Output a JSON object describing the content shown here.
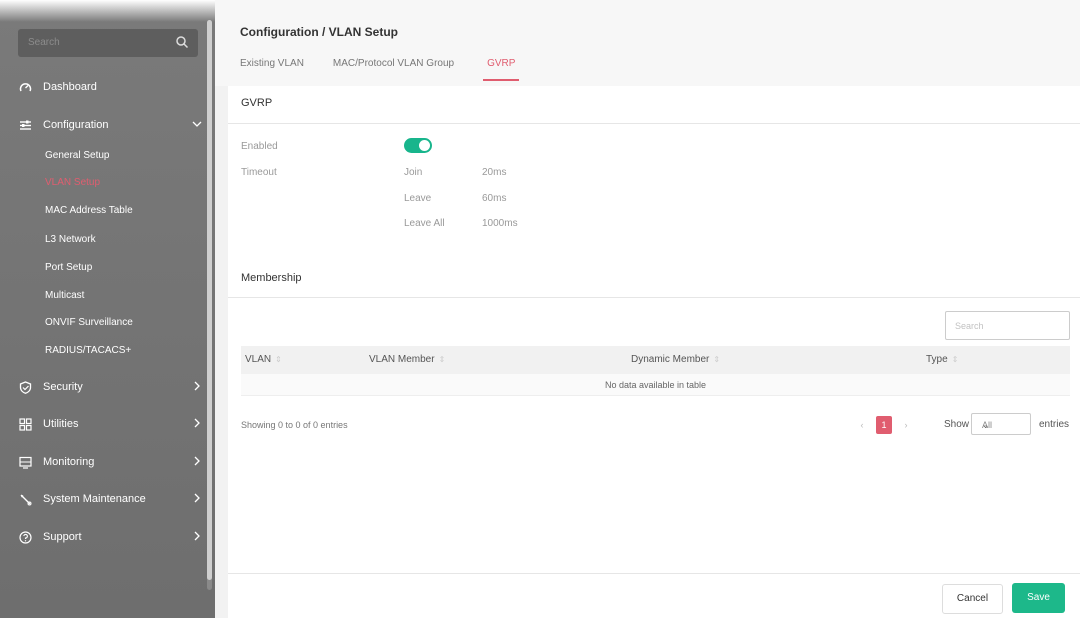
{
  "sidebar": {
    "search_placeholder": "Search",
    "items": {
      "dashboard": "Dashboard",
      "configuration": "Configuration",
      "security": "Security",
      "utilities": "Utilities",
      "monitoring": "Monitoring",
      "system_maintenance": "System Maintenance",
      "support": "Support"
    },
    "config_subitems": [
      "General Setup",
      "VLAN Setup",
      "MAC Address Table",
      "L3 Network",
      "Port Setup",
      "Multicast",
      "ONVIF Surveillance",
      "RADIUS/TACACS+"
    ],
    "active_subitem": "VLAN Setup"
  },
  "header": {
    "breadcrumb": "Configuration / VLAN Setup",
    "tabs": [
      "Existing VLAN",
      "MAC/Protocol VLAN Group",
      "GVRP"
    ],
    "active_tab": "GVRP"
  },
  "gvrp": {
    "title": "GVRP",
    "enabled_label": "Enabled",
    "enabled": true,
    "timeout_label": "Timeout",
    "join_label": "Join",
    "join_value": "20ms",
    "leave_label": "Leave",
    "leave_value": "60ms",
    "leave_all_label": "Leave All",
    "leave_all_value": "1000ms"
  },
  "membership": {
    "title": "Membership",
    "search_placeholder": "Search",
    "columns": [
      "VLAN",
      "VLAN Member",
      "Dynamic Member",
      "Type"
    ],
    "empty_message": "No data available in table",
    "showing": "Showing 0 to 0 of 0 entries",
    "pager": {
      "prev": "‹",
      "current": "1",
      "next": "›"
    },
    "show_label": "Show",
    "show_value": "All",
    "entries_label": "entries"
  },
  "actions": {
    "cancel": "Cancel",
    "save": "Save"
  },
  "colors": {
    "accent": "#e05d6f",
    "save": "#1db88a",
    "toggle": "#18b58c",
    "sidebar": "#747474"
  }
}
